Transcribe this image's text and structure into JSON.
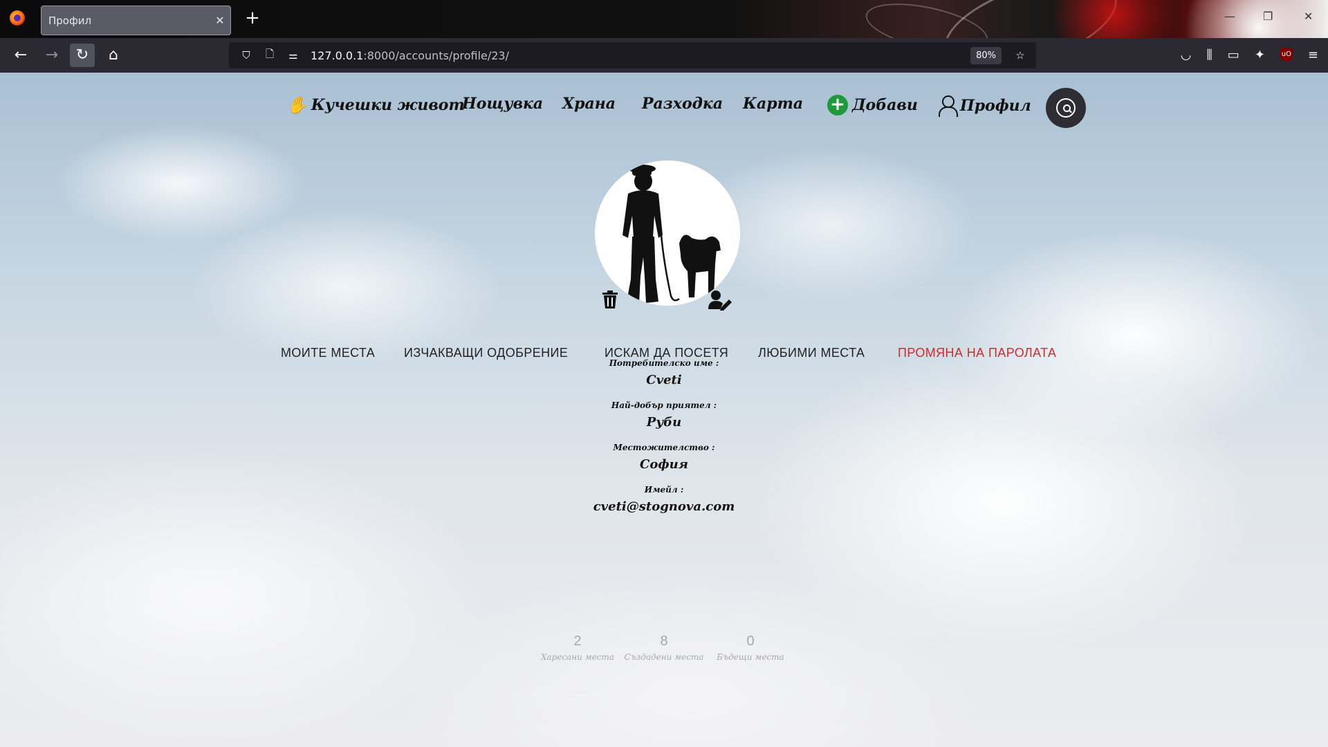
{
  "browser": {
    "tab_title": "Профил",
    "tab_close": "✕",
    "new_tab": "+",
    "url_host": "127.0.0.1",
    "url_path": ":8000/accounts/profile/23/",
    "zoom": "80%",
    "ublock_label": "uO"
  },
  "site_nav": {
    "brand": "Кучешки живот",
    "items": [
      "Нощувка",
      "Храна",
      "Разходка",
      "Карта"
    ],
    "add": "Добави",
    "add_icon": "+",
    "profile": "Профил",
    "paw_glyph": "✋"
  },
  "profile_tabs": [
    "Моите места",
    "Изчакващи одобрение",
    "Искам да посетя",
    "Любими места",
    "Промяна на паролата"
  ],
  "info": {
    "username_label": "Потребителско име :",
    "username": "Cveti",
    "friend_label": "Най-добър приятел :",
    "friend": "Руби",
    "location_label": "Местожителство :",
    "location": "София",
    "email_label": "Имейл :",
    "email": "cveti@stognova.com"
  },
  "stats": [
    {
      "num": "2",
      "caption": "Харесани места"
    },
    {
      "num": "8",
      "caption": "Създадени места"
    },
    {
      "num": "0",
      "caption": "Бъдещи места"
    }
  ],
  "colors": {
    "accent_red": "#d62828",
    "add_green": "#1f9a3a",
    "paw_green": "#2e7d32"
  }
}
